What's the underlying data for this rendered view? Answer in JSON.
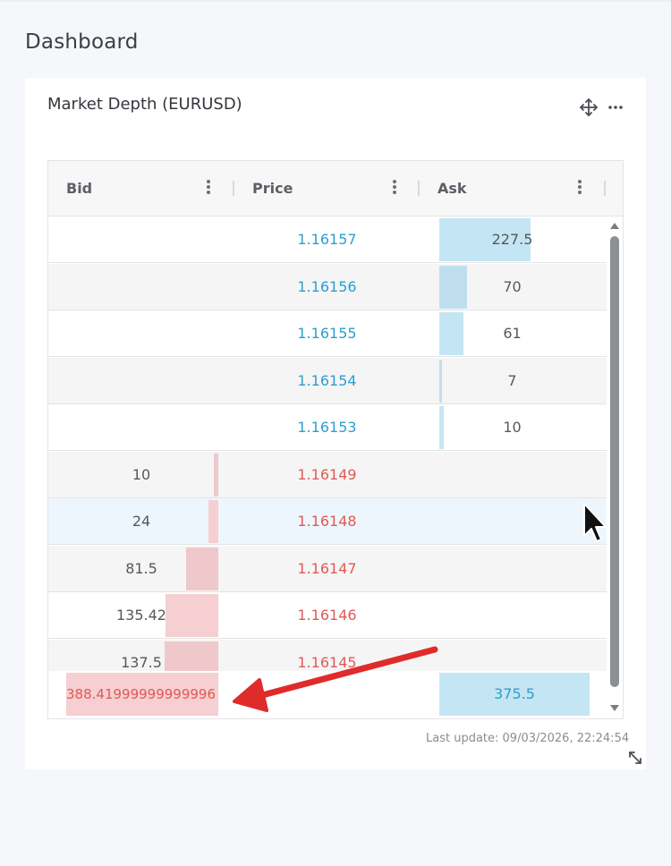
{
  "page": {
    "title": "Dashboard"
  },
  "widget": {
    "title": "Market Depth (EURUSD)",
    "icons": {
      "move": "move-icon",
      "more": "more-horizontal-icon",
      "resize": "resize-icon"
    },
    "columns": {
      "bid": "Bid",
      "price": "Price",
      "ask": "Ask"
    },
    "colors": {
      "ask_text": "#2a9fcf",
      "bid_text": "#e05a55",
      "ask_bar": "#c4e5f3",
      "bid_bar": "#f5cfd1",
      "hover_row": "#eef6fd",
      "annotation_arrow": "#e02b2b"
    },
    "rows": [
      {
        "bid": "",
        "price": "1.16157",
        "ask": "227.5",
        "side": "ask",
        "ask_ratio": 0.606,
        "bid_ratio": 0
      },
      {
        "bid": "",
        "price": "1.16156",
        "ask": "70",
        "side": "ask",
        "ask_ratio": 0.186,
        "bid_ratio": 0
      },
      {
        "bid": "",
        "price": "1.16155",
        "ask": "61",
        "side": "ask",
        "ask_ratio": 0.162,
        "bid_ratio": 0
      },
      {
        "bid": "",
        "price": "1.16154",
        "ask": "7",
        "side": "ask",
        "ask_ratio": 0.019,
        "bid_ratio": 0
      },
      {
        "bid": "",
        "price": "1.16153",
        "ask": "10",
        "side": "ask",
        "ask_ratio": 0.027,
        "bid_ratio": 0
      },
      {
        "bid": "10",
        "price": "1.16149",
        "ask": "",
        "side": "bid",
        "ask_ratio": 0,
        "bid_ratio": 0.026
      },
      {
        "bid": "24",
        "price": "1.16148",
        "ask": "",
        "side": "bid",
        "ask_ratio": 0,
        "bid_ratio": 0.062,
        "hover": true
      },
      {
        "bid": "81.5",
        "price": "1.16147",
        "ask": "",
        "side": "bid",
        "ask_ratio": 0,
        "bid_ratio": 0.21
      },
      {
        "bid": "135.42",
        "price": "1.16146",
        "ask": "",
        "side": "bid",
        "ask_ratio": 0,
        "bid_ratio": 0.349
      },
      {
        "bid": "137.5",
        "price": "1.16145",
        "ask": "",
        "side": "bid",
        "ask_ratio": 0,
        "bid_ratio": 0.354
      }
    ],
    "totals": {
      "bid": "388.41999999999996",
      "ask": "375.5"
    },
    "last_update": "Last update: 09/03/2026, 22:24:54"
  }
}
